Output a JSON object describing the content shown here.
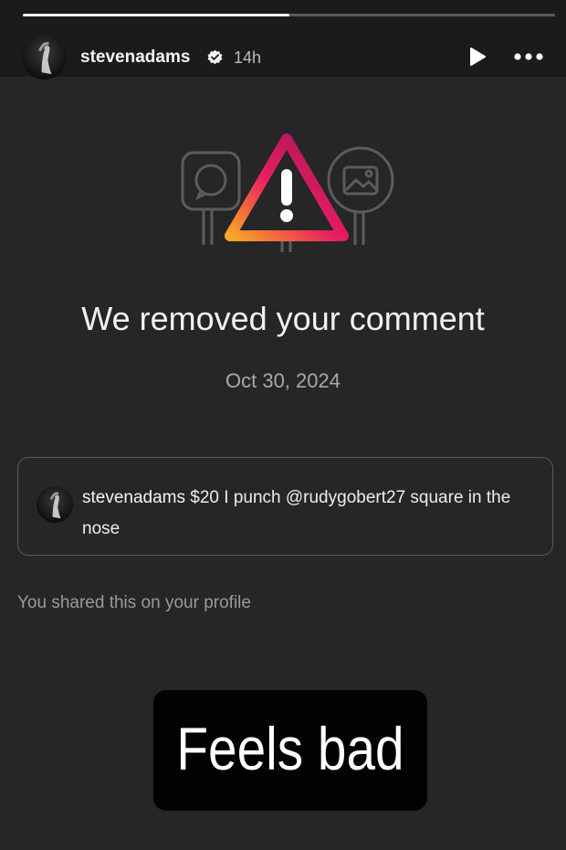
{
  "header": {
    "username": "stevenadams",
    "time": "14h",
    "progress_fraction": 0.5,
    "icons": [
      "verified-badge-icon",
      "play-icon",
      "more-dots-icon"
    ]
  },
  "notice": {
    "title": "We removed your comment",
    "date": "Oct 30, 2024",
    "illustration_icons": [
      "comment-bubble-icon",
      "warning-triangle-icon",
      "image-icon"
    ]
  },
  "comment": {
    "username": "stevenadams",
    "text": "$20 I punch @rudygobert27 square in the nose"
  },
  "shared_note": "You shared this on your profile",
  "sticker": {
    "text": "Feels bad"
  },
  "colors": {
    "background": "#262626",
    "topbar": "#1b1b1b",
    "gradient": [
      "#f9a825",
      "#e91e63",
      "#c2185b",
      "#7b1fa2"
    ]
  }
}
